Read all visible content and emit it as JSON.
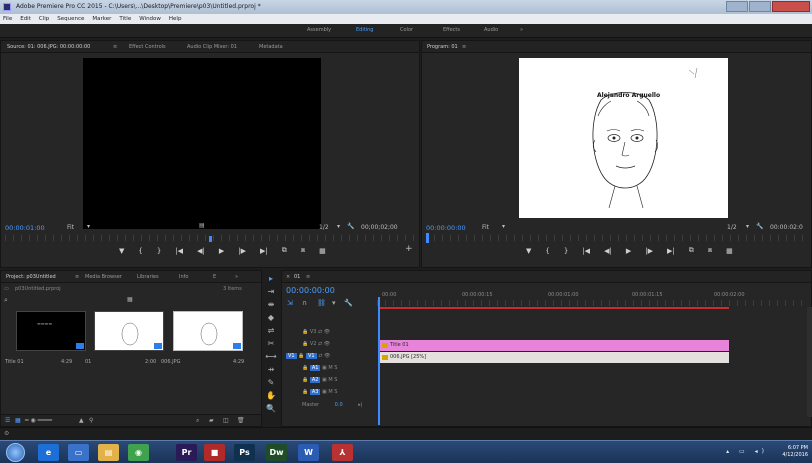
{
  "window": {
    "title": "Adobe Premiere Pro CC 2015 - C:\\Users\\...\\Desktop\\Premiere\\p03\\Untitled.prproj *"
  },
  "menu": [
    "File",
    "Edit",
    "Clip",
    "Sequence",
    "Marker",
    "Title",
    "Window",
    "Help"
  ],
  "workspaces": {
    "items": [
      "Assembly",
      "Editing",
      "Color",
      "Effects",
      "Audio"
    ],
    "active": "Editing"
  },
  "source": {
    "tabs": [
      "Source: 01: 006.JPG: 00:00:00:00",
      "Effect Controls",
      "Audio Clip Mixer: 01",
      "Metadata"
    ],
    "timecode": "00:00:01:00",
    "fit": "Fit",
    "resolution": "1/2",
    "duration": "00;00;02;00"
  },
  "program": {
    "tab": "Program: 01",
    "timecode": "00:00:00:00",
    "fit": "Fit",
    "resolution": "1/2",
    "duration": "00:00:02:0",
    "frame_caption": "Alejandro Arguello"
  },
  "transport": {
    "icons": [
      "▼",
      "{",
      "}",
      "|◀",
      "◀|",
      "▶",
      "|▶",
      "▶|",
      "⧉",
      "⧈",
      "▦"
    ]
  },
  "project": {
    "tabs": [
      "Project: p03Untitled",
      "Media Browser",
      "Libraries",
      "Info",
      "E"
    ],
    "path": "p03Untitled.prproj",
    "item_count": "3 Items",
    "items": [
      {
        "name": "Title 01",
        "duration": "4:29"
      },
      {
        "name": "01",
        "duration": "2:00"
      },
      {
        "name": "006.JPG",
        "duration": "4:29"
      }
    ]
  },
  "timeline": {
    "tab": "01",
    "timecode": "00:00:00:00",
    "ruler_labels": [
      "00:00",
      "00:00:00:15",
      "00:00:01:00",
      "00:00:01:15",
      "00:00:02:00"
    ],
    "tracks": [
      {
        "name": "V3"
      },
      {
        "name": "V2"
      },
      {
        "name": "V1"
      },
      {
        "name": "A1"
      },
      {
        "name": "A2"
      },
      {
        "name": "A3"
      },
      {
        "name": "Master",
        "value": "0.0"
      }
    ],
    "clips": [
      {
        "label": "Title 01",
        "color": "#e783d8"
      },
      {
        "label": "006.JPG [25%]",
        "color": "#e4e0dd"
      }
    ]
  },
  "tools": [
    "▸",
    "⇥",
    "⇼",
    "◆",
    "⇌",
    "✂",
    "⟷",
    "⇸",
    "✎",
    "✋",
    "🔍"
  ],
  "taskbar": {
    "apps": [
      {
        "name": "ie-icon",
        "text": "e",
        "color": "#1c6fd6"
      },
      {
        "name": "explorer-icon",
        "text": "▭",
        "color": "#3a71c9"
      },
      {
        "name": "folder-icon",
        "text": "▤",
        "color": "#e3b14a"
      },
      {
        "name": "chrome-icon",
        "text": "◉",
        "color": "#3fa34d"
      },
      {
        "name": "premiere-icon",
        "text": "Pr",
        "color": "#2a1a57"
      },
      {
        "name": "app-red-icon",
        "text": "■",
        "color": "#b02a2a"
      },
      {
        "name": "photoshop-icon",
        "text": "Ps",
        "color": "#10304f"
      },
      {
        "name": "dreamweaver-icon",
        "text": "Dw",
        "color": "#1f4d28"
      },
      {
        "name": "word-icon",
        "text": "W",
        "color": "#2a5cb3"
      },
      {
        "name": "acrobat-icon",
        "text": "⅄",
        "color": "#b83232"
      }
    ],
    "time": "6:07 PM",
    "date": "4/12/2016"
  }
}
